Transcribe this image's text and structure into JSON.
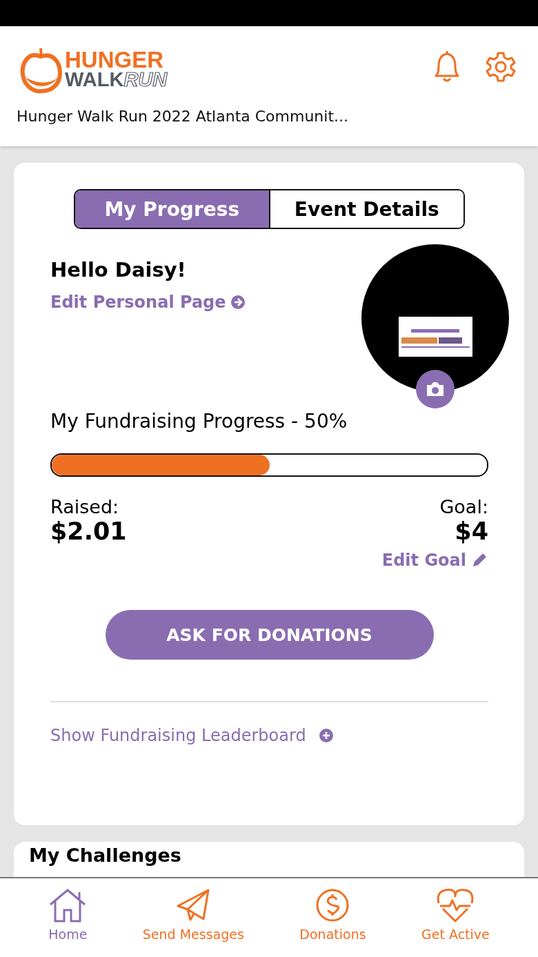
{
  "header": {
    "logo": {
      "line1": "HUNGER",
      "line2a": "WALK",
      "line2b": "RUN"
    },
    "event_title": "Hunger Walk Run 2022 Atlanta Communit..."
  },
  "tabs": [
    {
      "label": "My Progress",
      "selected": true
    },
    {
      "label": "Event Details",
      "selected": false
    }
  ],
  "profile": {
    "greeting": "Hello Daisy!",
    "edit_link": "Edit Personal Page"
  },
  "fundraising": {
    "title": "My Fundraising Progress - 50%",
    "level": 0.5,
    "raised_label": "Raised:",
    "raised": "$2.01",
    "goal_label": "Goal:",
    "goal": "$4",
    "edit_goal": "Edit Goal"
  },
  "ask_button": "ASK FOR DONATIONS",
  "leaderboard_link": "Show Fundraising Leaderboard",
  "challenges": {
    "title": "My Challenges"
  },
  "nav": [
    {
      "label": "Home",
      "kind": "home",
      "selected": true
    },
    {
      "label": "Send Messages",
      "kind": "send",
      "selected": false
    },
    {
      "label": "Donations",
      "kind": "donate",
      "selected": false
    },
    {
      "label": "Get Active",
      "kind": "active",
      "selected": false
    }
  ]
}
